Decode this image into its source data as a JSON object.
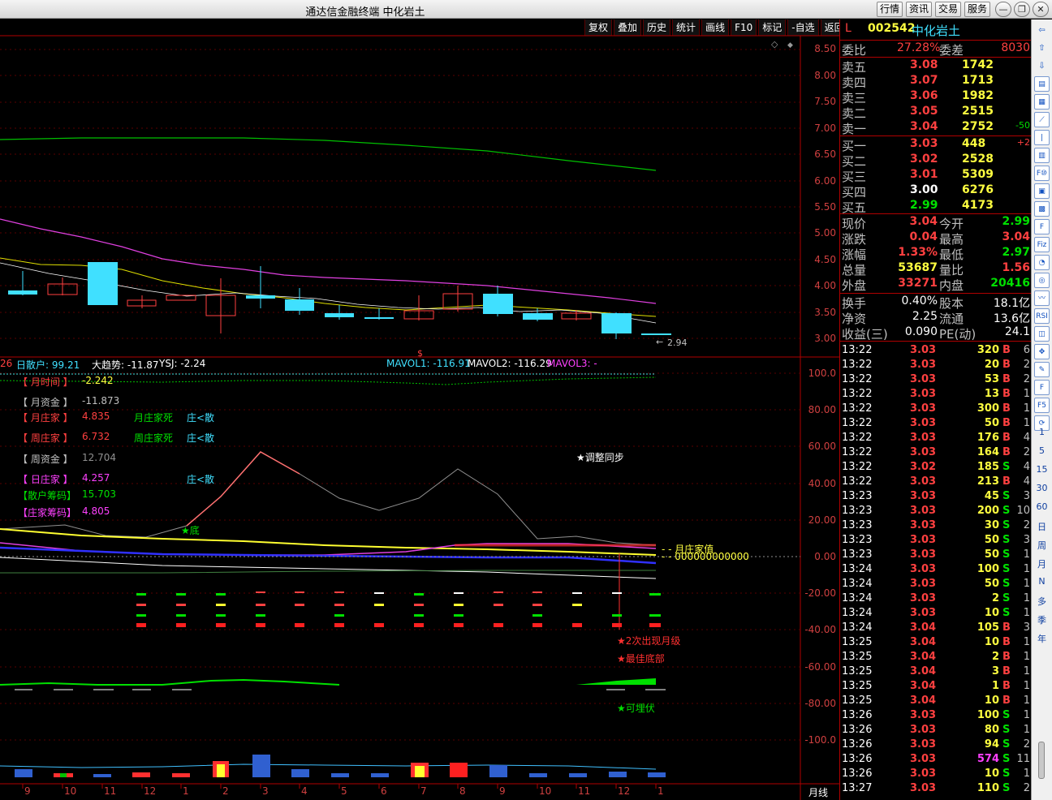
{
  "window": {
    "title": "通达信金融终端 中化岩土",
    "buttons": [
      "行情",
      "资讯",
      "交易",
      "服务"
    ]
  },
  "toolbar": [
    "复权",
    "叠加",
    "历史",
    "统计",
    "画线",
    "F10",
    "标记",
    "-自选",
    "返回"
  ],
  "price_axis": [
    "8.50",
    "8.00",
    "7.50",
    "7.00",
    "6.50",
    "6.00",
    "5.50",
    "5.00",
    "4.50",
    "4.00",
    "3.50",
    "3.00"
  ],
  "price_chart": {
    "last_low_label": "2.94",
    "marker": "$"
  },
  "indicator_header": {
    "left_num": "26",
    "sanhu": "日散户: 99.21",
    "trend": "大趋势: -11.87",
    "ysj": "YSJ: -2.24",
    "mavol1": "MAVOL1: -116.91",
    "mavol2": "MAVOL2: -116.29",
    "mavol3": "MAVOL3: -"
  },
  "indicators": [
    {
      "label": "【 月时间 】",
      "value": "-2.242",
      "color": "#ff4040",
      "vcolor": "#ffff40"
    },
    {
      "label": "【 月资金 】",
      "value": "-11.873",
      "color": "#c0c0c0",
      "vcolor": "#c0c0c0"
    },
    {
      "label": "【 月庄家 】",
      "value": "4.835",
      "color": "#ff4040",
      "vcolor": "#ff4040"
    },
    {
      "label": "【 周庄家 】",
      "value": "6.732",
      "color": "#ff4040",
      "vcolor": "#ff4040"
    },
    {
      "label": "【 周资金 】",
      "value": "12.704",
      "color": "#c0c0c0",
      "vcolor": "#909090"
    },
    {
      "label": "【 日庄家 】",
      "value": "4.257",
      "color": "#ff40ff",
      "vcolor": "#ff40ff"
    },
    {
      "label": "【散户筹码】",
      "value": "15.703",
      "color": "#00e000",
      "vcolor": "#00e000"
    },
    {
      "label": "【庄家筹码】",
      "value": "4.805",
      "color": "#ff40ff",
      "vcolor": "#ff40ff"
    }
  ],
  "signals": {
    "month_dead": "月庄家死",
    "week_dead": "周庄家死",
    "zhuang1": "庄<散",
    "zhuang2": "庄<散",
    "zhuang3": "庄<散",
    "adjust": "★调整同步",
    "bottom": "★底",
    "month_value": "月庄家值",
    "zeros": "000000000000",
    "twice": "★2次出现月级",
    "best": "★最佳底部",
    "ambush": "★可埋伏"
  },
  "indicator_axis": [
    "100.0",
    "80.00",
    "60.00",
    "40.00",
    "20.00",
    "0.00",
    "-20.00",
    "-40.00",
    "-60.00",
    "-80.00",
    "-100.0"
  ],
  "x_axis": [
    "9",
    "10",
    "11",
    "12",
    "1",
    "2",
    "3",
    "4",
    "5",
    "6",
    "7",
    "8",
    "9",
    "10",
    "11",
    "12",
    "1"
  ],
  "period_label": "月线",
  "quote": {
    "code": "002542",
    "name": "中化岩土",
    "flag": "L",
    "weibi_label": "委比",
    "weibi": "27.28%",
    "weicha_label": "委差",
    "weicha": "8030",
    "asks": [
      {
        "label": "卖五",
        "price": "3.08",
        "vol": "1742",
        "chg": ""
      },
      {
        "label": "卖四",
        "price": "3.07",
        "vol": "1713",
        "chg": ""
      },
      {
        "label": "卖三",
        "price": "3.06",
        "vol": "1982",
        "chg": ""
      },
      {
        "label": "卖二",
        "price": "3.05",
        "vol": "2515",
        "chg": ""
      },
      {
        "label": "卖一",
        "price": "3.04",
        "vol": "2752",
        "chg": "-50"
      }
    ],
    "bids": [
      {
        "label": "买一",
        "price": "3.03",
        "vol": "448",
        "chg": "+2"
      },
      {
        "label": "买二",
        "price": "3.02",
        "vol": "2528",
        "chg": ""
      },
      {
        "label": "买三",
        "price": "3.01",
        "vol": "5309",
        "chg": ""
      },
      {
        "label": "买四",
        "price": "3.00",
        "vol": "6276",
        "chg": ""
      },
      {
        "label": "买五",
        "price": "2.99",
        "vol": "4173",
        "chg": ""
      }
    ],
    "stats1": [
      {
        "l1": "现价",
        "v1": "3.04",
        "c1": "red",
        "l2": "今开",
        "v2": "2.99",
        "c2": "green"
      },
      {
        "l1": "涨跌",
        "v1": "0.04",
        "c1": "red",
        "l2": "最高",
        "v2": "3.04",
        "c2": "red"
      },
      {
        "l1": "涨幅",
        "v1": "1.33%",
        "c1": "red",
        "l2": "最低",
        "v2": "2.97",
        "c2": "green"
      },
      {
        "l1": "总量",
        "v1": "53687",
        "c1": "yellow",
        "l2": "量比",
        "v2": "1.56",
        "c2": "red"
      },
      {
        "l1": "外盘",
        "v1": "33271",
        "c1": "red",
        "l2": "内盘",
        "v2": "20416",
        "c2": "green"
      }
    ],
    "stats2": [
      {
        "l1": "换手",
        "v1": "0.40%",
        "l2": "股本",
        "v2": "18.1亿"
      },
      {
        "l1": "净资",
        "v1": "2.25",
        "l2": "流通",
        "v2": "13.6亿"
      },
      {
        "l1": "收益(三)",
        "v1": "0.090",
        "l2": "PE(动)",
        "v2": "24.1"
      }
    ]
  },
  "ticks": [
    [
      "13:22",
      "3.03",
      "320",
      "B",
      "6"
    ],
    [
      "13:22",
      "3.03",
      "20",
      "B",
      "2"
    ],
    [
      "13:22",
      "3.03",
      "53",
      "B",
      "2"
    ],
    [
      "13:22",
      "3.03",
      "13",
      "B",
      "1"
    ],
    [
      "13:22",
      "3.03",
      "300",
      "B",
      "1"
    ],
    [
      "13:22",
      "3.03",
      "50",
      "B",
      "1"
    ],
    [
      "13:22",
      "3.03",
      "176",
      "B",
      "4"
    ],
    [
      "13:22",
      "3.03",
      "164",
      "B",
      "2"
    ],
    [
      "13:22",
      "3.02",
      "185",
      "S",
      "4"
    ],
    [
      "13:22",
      "3.03",
      "213",
      "B",
      "4"
    ],
    [
      "13:23",
      "3.03",
      "45",
      "S",
      "3"
    ],
    [
      "13:23",
      "3.03",
      "200",
      "S",
      "10"
    ],
    [
      "13:23",
      "3.03",
      "30",
      "S",
      "2"
    ],
    [
      "13:23",
      "3.03",
      "50",
      "S",
      "3"
    ],
    [
      "13:23",
      "3.03",
      "50",
      "S",
      "1"
    ],
    [
      "13:24",
      "3.03",
      "100",
      "S",
      "1"
    ],
    [
      "13:24",
      "3.03",
      "50",
      "S",
      "1"
    ],
    [
      "13:24",
      "3.03",
      "2",
      "S",
      "1"
    ],
    [
      "13:24",
      "3.03",
      "10",
      "S",
      "1"
    ],
    [
      "13:24",
      "3.04",
      "105",
      "B",
      "3"
    ],
    [
      "13:25",
      "3.04",
      "10",
      "B",
      "1"
    ],
    [
      "13:25",
      "3.04",
      "2",
      "B",
      "1"
    ],
    [
      "13:25",
      "3.04",
      "3",
      "B",
      "1"
    ],
    [
      "13:25",
      "3.04",
      "1",
      "B",
      "1"
    ],
    [
      "13:25",
      "3.04",
      "10",
      "B",
      "1"
    ],
    [
      "13:26",
      "3.03",
      "100",
      "S",
      "1"
    ],
    [
      "13:26",
      "3.03",
      "80",
      "S",
      "1"
    ],
    [
      "13:26",
      "3.03",
      "94",
      "S",
      "2"
    ],
    [
      "13:26",
      "3.03",
      "574",
      "S",
      "11"
    ],
    [
      "13:26",
      "3.03",
      "10",
      "S",
      "1"
    ],
    [
      "13:27",
      "3.03",
      "110",
      "S",
      "2"
    ]
  ],
  "sidebar": {
    "icons": [
      "arrow-left-icon",
      "arrow-up-icon",
      "arrow-down-icon",
      "list-icon",
      "table-icon",
      "chart-line-icon",
      "candle-icon",
      "bar-icon",
      "f10-icon",
      "calendar-icon",
      "grid-icon",
      "f-icon",
      "fiz-icon",
      "circle-icon",
      "menu-icon",
      "wave-icon",
      "rsi-icon",
      "chart-icon",
      "move-icon",
      "pencil-icon",
      "f-icon",
      "f5-icon",
      "refresh-icon"
    ],
    "icon_text": [
      "⇦",
      "⇧",
      "⇩",
      "▤",
      "▦",
      "⟋",
      "❘",
      "▥",
      "F⑩",
      "▣",
      "▩",
      "F",
      "Fiz",
      "◔",
      "◎",
      "〰",
      "RSI",
      "◫",
      "✥",
      "✎",
      "F",
      "F5",
      "⟳"
    ],
    "periods": [
      "1",
      "5",
      "15",
      "30",
      "60",
      "日",
      "周",
      "月",
      "N",
      "多",
      "季",
      "年"
    ]
  },
  "colors": {
    "up": "#ff4040",
    "down": "#40e0ff",
    "border": "#b00000"
  }
}
